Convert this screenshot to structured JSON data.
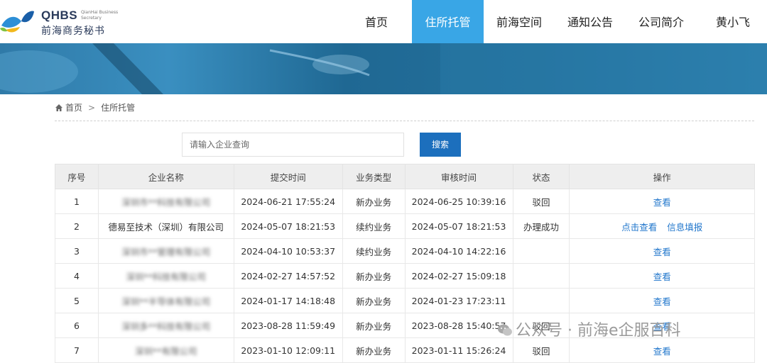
{
  "logo": {
    "name": "QHBS",
    "subtitle": "QianHai Business Secretary",
    "cn": "前海商务秘书"
  },
  "nav": {
    "items": [
      {
        "label": "首页",
        "active": false
      },
      {
        "label": "住所托管",
        "active": true
      },
      {
        "label": "前海空间",
        "active": false
      },
      {
        "label": "通知公告",
        "active": false
      },
      {
        "label": "公司简介",
        "active": false
      },
      {
        "label": "黄小飞",
        "active": false
      }
    ]
  },
  "breadcrumb": {
    "home": "首页",
    "separator": ">",
    "current": "住所托管"
  },
  "search": {
    "placeholder": "请输入企业查询",
    "button": "搜索"
  },
  "table": {
    "headers": [
      "序号",
      "企业名称",
      "提交时间",
      "业务类型",
      "审核时间",
      "状态",
      "操作"
    ],
    "rows": [
      {
        "no": "1",
        "name": "深圳市**科技有限公司",
        "submit": "2024-06-21 17:55:24",
        "type": "新办业务",
        "review": "2024-06-25 10:39:16",
        "status": "驳回",
        "op1": "查看",
        "op2": ""
      },
      {
        "no": "2",
        "name": "德易至技术（深圳）有限公司",
        "submit": "2024-05-07 18:21:53",
        "type": "续约业务",
        "review": "2024-05-07 18:21:53",
        "status": "办理成功",
        "op1": "点击查看",
        "op2": "信息填报"
      },
      {
        "no": "3",
        "name": "深圳市**管理有限公司",
        "submit": "2024-04-10 10:53:37",
        "type": "续约业务",
        "review": "2024-04-10 14:22:16",
        "status": "",
        "op1": "查看",
        "op2": ""
      },
      {
        "no": "4",
        "name": "深圳**科技有限公司",
        "submit": "2024-02-27 14:57:52",
        "type": "新办业务",
        "review": "2024-02-27 15:09:18",
        "status": "",
        "op1": "查看",
        "op2": ""
      },
      {
        "no": "5",
        "name": "深圳**半导体有限公司",
        "submit": "2024-01-17 14:18:48",
        "type": "新办业务",
        "review": "2024-01-23 17:23:11",
        "status": "",
        "op1": "查看",
        "op2": ""
      },
      {
        "no": "6",
        "name": "深圳多**科技有限公司",
        "submit": "2023-08-28 11:59:49",
        "type": "新办业务",
        "review": "2023-08-28 15:40:57",
        "status": "驳回",
        "op1": "查看",
        "op2": ""
      },
      {
        "no": "7",
        "name": "深圳**有限公司",
        "submit": "2023-01-10 12:09:11",
        "type": "新办业务",
        "review": "2023-01-11 15:26:24",
        "status": "驳回",
        "op1": "查看",
        "op2": ""
      }
    ]
  },
  "watermark": {
    "text": "公众号 · 前海e企服百科"
  },
  "colors": {
    "nav_active": "#39a6e6",
    "search_button": "#1c6fbd",
    "link": "#2277cc"
  }
}
